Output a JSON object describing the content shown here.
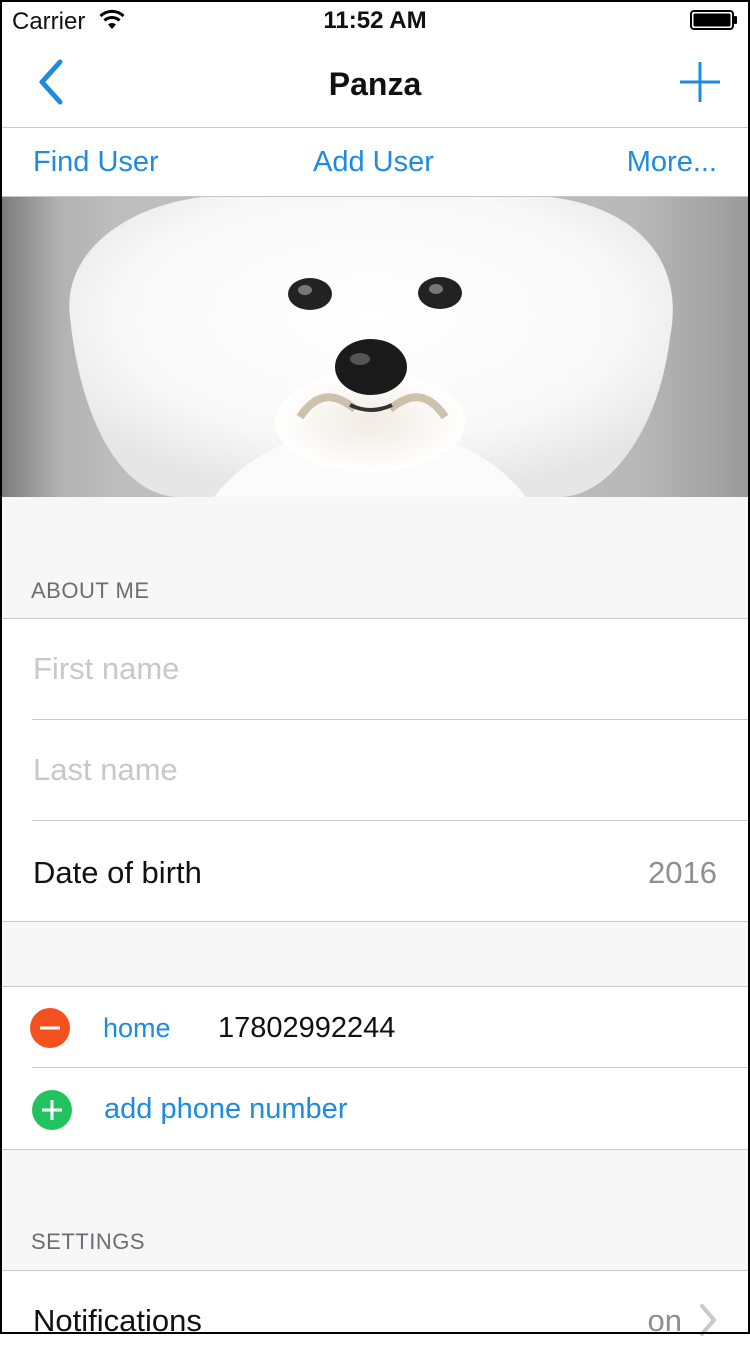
{
  "status_bar": {
    "carrier": "Carrier",
    "time": "11:52 AM"
  },
  "nav": {
    "title": "Panza",
    "back_icon": "chevron-left-icon",
    "add_icon": "plus-icon"
  },
  "toolbar": {
    "find_user": "Find User",
    "add_user": "Add User",
    "more": "More..."
  },
  "profile": {
    "photo": "bichon-frise-dog-photo"
  },
  "about_me": {
    "header": "ABOUT ME",
    "first_name_placeholder": "First name",
    "last_name_placeholder": "Last name",
    "dob_label": "Date of birth",
    "dob_value": "2016"
  },
  "phones": {
    "items": [
      {
        "type": "home",
        "number": "17802992244"
      }
    ],
    "add_label": "add phone number"
  },
  "settings": {
    "header": "SETTINGS",
    "notifications_label": "Notifications",
    "notifications_value": "on"
  },
  "colors": {
    "accent": "#1d8be0",
    "delete": "#f4511e",
    "add": "#21c35f"
  }
}
